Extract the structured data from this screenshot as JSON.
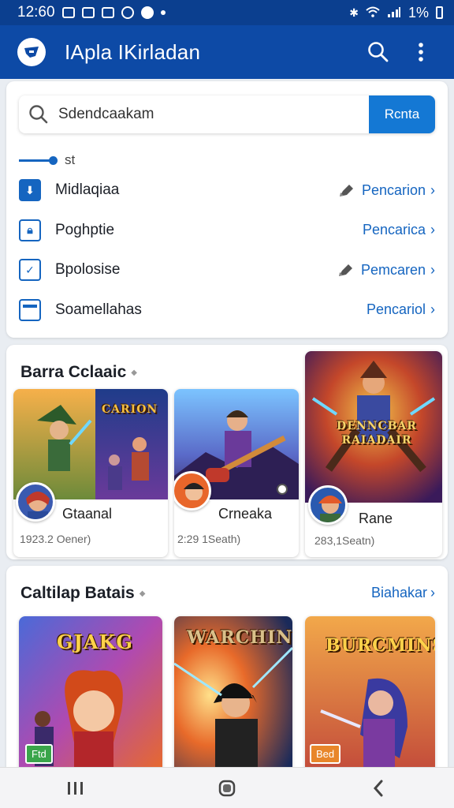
{
  "status_bar": {
    "time": "12:60",
    "battery": "1%"
  },
  "app_bar": {
    "title": "IApla IKirladan"
  },
  "search": {
    "value": "Sdendcaakam",
    "button_label": "Rcnta"
  },
  "slider": {
    "label": "st"
  },
  "list": [
    {
      "label": "Midlaqiaa",
      "action": "Pencarion",
      "has_pen": true
    },
    {
      "label": "Poghptie",
      "action": "Pencarica",
      "has_pen": false
    },
    {
      "label": "Bpolosise",
      "action": "Pemcaren",
      "has_pen": true
    },
    {
      "label": "Soamellahas",
      "action": "Pencariol",
      "has_pen": false
    }
  ],
  "section1": {
    "title": "Barra Cclaaic",
    "games": [
      {
        "name": "Gtaanal",
        "meta": "1923.2 Oener)",
        "art_title": "CARION"
      },
      {
        "name": "Crneaka",
        "meta": "2:29 1Seath)"
      },
      {
        "name": "Rane",
        "meta": "283,1Seatn)",
        "art_title": "DENNCBAR RAIADAIR"
      }
    ]
  },
  "section2": {
    "title": "Caltilap Batais",
    "link": "Biahakar",
    "games": [
      {
        "art_title": "GJAKG",
        "badge": "Ftd"
      },
      {
        "art_title": "WARCHIN"
      },
      {
        "art_title": "BURCMINS",
        "badge": "Bed"
      }
    ]
  },
  "colors": {
    "app_bar": "#0d4aa6",
    "accent": "#1478d4",
    "link": "#1565c0"
  }
}
